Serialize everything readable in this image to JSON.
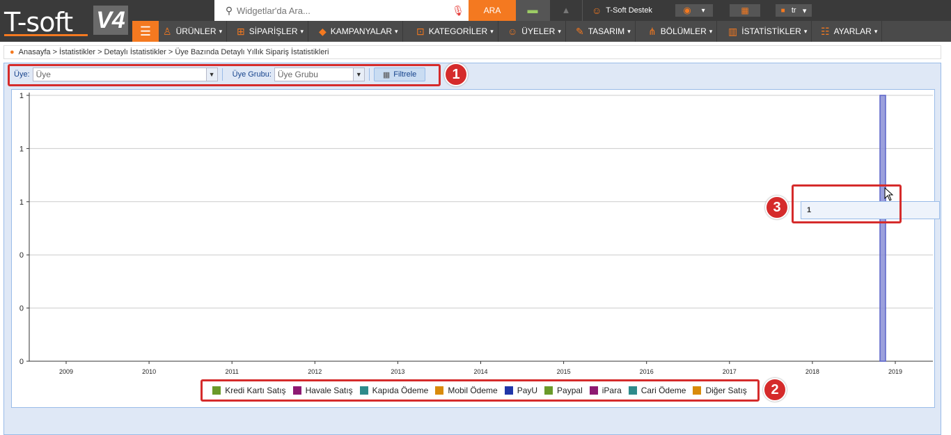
{
  "header": {
    "logo_text": "T-soft",
    "logo_version": "V4",
    "search_placeholder": "Widgetlar'da Ara...",
    "search_button": "ARA",
    "user_name": "T-Soft Destek",
    "language": "tr",
    "icons": {
      "search": "search-icon",
      "mic": "microphone-icon",
      "messages": "chat-icon",
      "warnings": "warning-icon",
      "user": "user-icon",
      "eye": "eye-icon",
      "grid": "grid-icon",
      "flag": "flag-icon"
    }
  },
  "nav": {
    "items": [
      {
        "label": "ÜRÜNLER",
        "icon": "shirt-icon"
      },
      {
        "label": "SİPARİŞLER",
        "icon": "cart-icon"
      },
      {
        "label": "KAMPANYALAR",
        "icon": "tag-icon"
      },
      {
        "label": "KATEGORİLER",
        "icon": "sitemap-icon"
      },
      {
        "label": "ÜYELER",
        "icon": "users-icon"
      },
      {
        "label": "TASARIM",
        "icon": "brush-icon"
      },
      {
        "label": "BÖLÜMLER",
        "icon": "sections-icon"
      },
      {
        "label": "İSTATİSTİKLER",
        "icon": "chart-icon"
      },
      {
        "label": "AYARLAR",
        "icon": "settings-icon"
      }
    ]
  },
  "breadcrumb": "Anasayfa > İstatistikler > Detaylı İstatistikler > Üye Bazında Detaylı Yıllık Sipariş İstatistikleri",
  "filters": {
    "member_label": "Üye:",
    "member_placeholder": "Üye",
    "group_label": "Üye Grubu:",
    "group_placeholder": "Üye Grubu",
    "filter_button": "Filtrele"
  },
  "badges": [
    "1",
    "2",
    "3"
  ],
  "tooltip": "1",
  "colors": {
    "accent": "#f47920",
    "annotation": "#d52b2b",
    "bar": "#8a8fd6"
  },
  "chart_data": {
    "type": "bar",
    "categories": [
      "2009",
      "2010",
      "2011",
      "2012",
      "2013",
      "2014",
      "2015",
      "2016",
      "2017",
      "2018",
      "2019"
    ],
    "y_tick_labels": [
      "0",
      "0",
      "0",
      "1",
      "1",
      "1"
    ],
    "ylim": [
      0,
      1
    ],
    "grid": true,
    "legend_position": "bottom",
    "bars": [
      {
        "x": "2019",
        "value": 1
      }
    ],
    "legend": [
      {
        "name": "Kredi Kartı Satış",
        "color": "#6a9a2a"
      },
      {
        "name": "Havale Satış",
        "color": "#8e1a72"
      },
      {
        "name": "Kapıda Ödeme",
        "color": "#2e8b8b"
      },
      {
        "name": "Mobil Ödeme",
        "color": "#d98b0b"
      },
      {
        "name": "PayU",
        "color": "#2036a8"
      },
      {
        "name": "Paypal",
        "color": "#6a9a2a"
      },
      {
        "name": "iPara",
        "color": "#8e1a72"
      },
      {
        "name": "Cari Ödeme",
        "color": "#2e8b8b"
      },
      {
        "name": "Diğer Satış",
        "color": "#d98b0b"
      }
    ]
  }
}
